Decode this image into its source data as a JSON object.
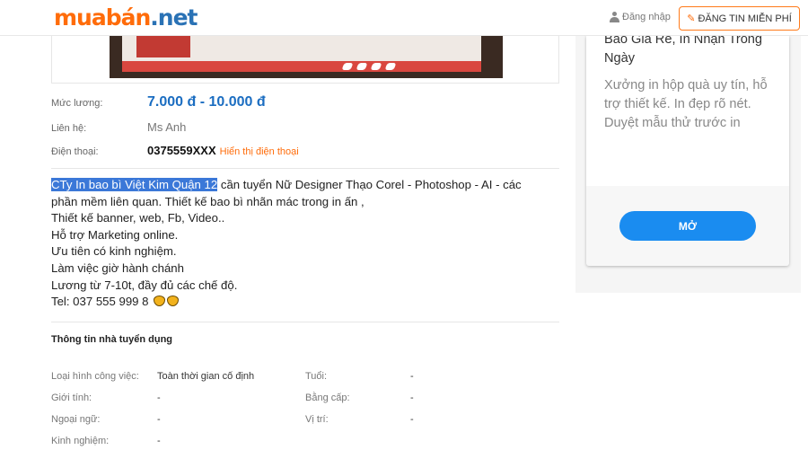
{
  "header": {
    "logo_brand": "muabán",
    "logo_tld": ".net",
    "login_label": "Đăng nhập",
    "post_button_label": "ĐĂNG TIN MIỄN PHÍ"
  },
  "job": {
    "salary_label": "Mức lương:",
    "salary_value": "7.000 đ - 10.000 đ",
    "contact_label": "Liên hệ:",
    "contact_value": "Ms Anh",
    "phone_label": "Điện thoại:",
    "phone_value": "0375559XXX",
    "show_phone_link": "Hiển thị điện thoại"
  },
  "description": {
    "highlighted": "CTy In bao bì Việt Kim Quận 12",
    "line1_rest": " cần tuyển Nữ Designer Thạo Corel - Photoshop - AI - các",
    "line2": "phần mềm liên quan. Thiết kế bao bì nhãn mác trong in ấn ,",
    "line3": "Thiết kế banner, web, Fb, Video..",
    "line4": "Hỗ trợ Marketing online.",
    "line5": "Ưu tiên có kinh nghiệm.",
    "line6": "Làm việc giờ hành chánh",
    "line7": "Lương từ 7-10t, đầy đủ các chế độ.",
    "line8": "Tel: 037 555 999 8"
  },
  "employer": {
    "section_title": "Thông tin nhà tuyển dụng",
    "job_type_label": "Loại hình công việc:",
    "job_type_value": "Toàn thời gian cố định",
    "age_label": "Tuổi:",
    "age_value": "-",
    "gender_label": "Giới tính:",
    "gender_value": "-",
    "degree_label": "Bằng cấp:",
    "degree_value": "-",
    "language_label": "Ngoại ngữ:",
    "language_value": "-",
    "position_label": "Vị trí:",
    "position_value": "-",
    "experience_label": "Kinh nghiệm:",
    "experience_value": "-"
  },
  "sidebar_ad": {
    "title": "Báo Giá Rẻ, In Nhận Trong Ngày",
    "text": "Xưởng in hộp quà uy tín, hỗ trợ thiết kế. In đẹp rõ nét. Duyệt mẫu thử trước in",
    "button_label": "MỞ"
  },
  "colors": {
    "brand_orange": "#ff6c0a",
    "brand_blue": "#1b6dc1",
    "cta_blue": "#1a8cf0"
  }
}
